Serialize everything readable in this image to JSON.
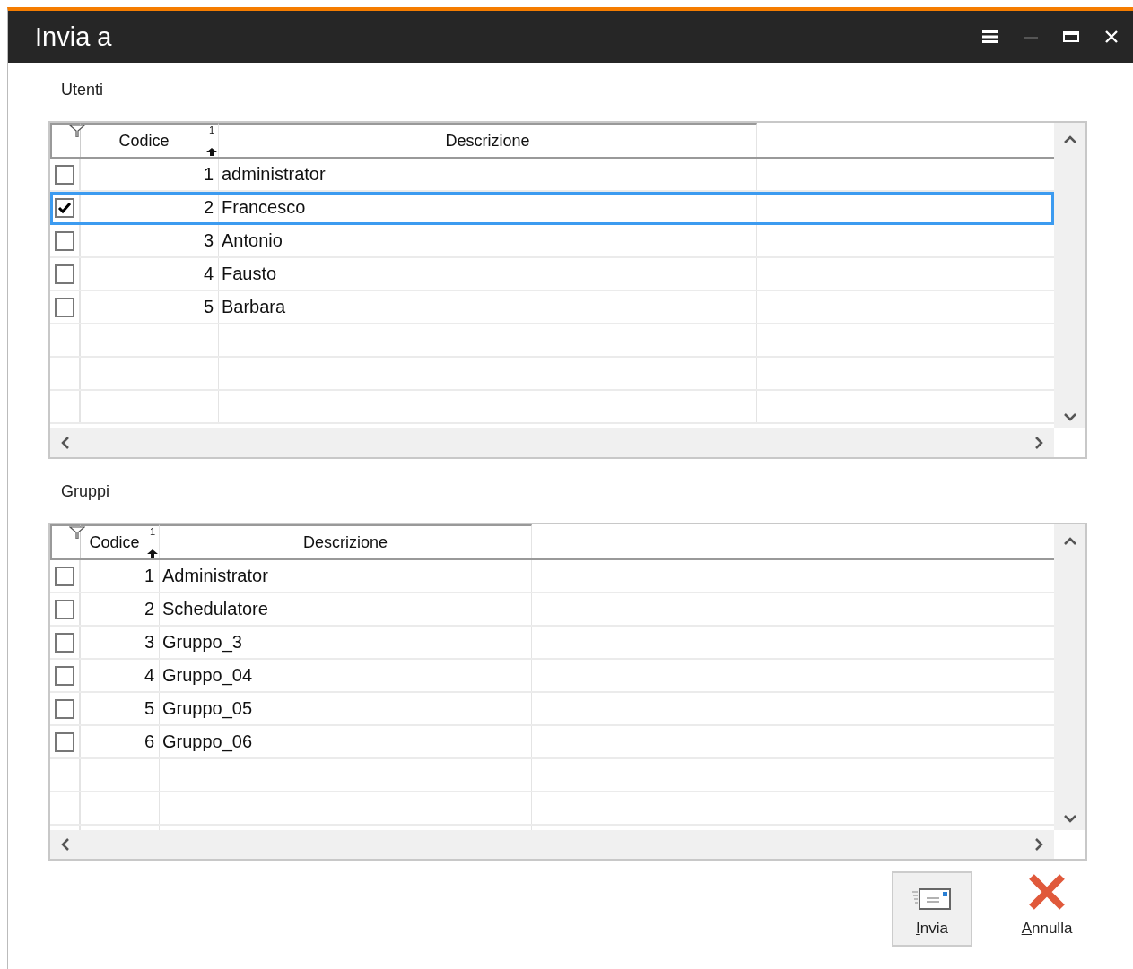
{
  "window": {
    "title": "Invia a"
  },
  "grids": [
    {
      "label": "Utenti",
      "columns": [
        {
          "title": "Codice",
          "sort_order": "1"
        },
        {
          "title": "Descrizione"
        }
      ],
      "rows": [
        {
          "code": "1",
          "description": "administrator",
          "checked": false,
          "selected": false
        },
        {
          "code": "2",
          "description": "Francesco",
          "checked": true,
          "selected": true
        },
        {
          "code": "3",
          "description": "Antonio",
          "checked": false,
          "selected": false
        },
        {
          "code": "4",
          "description": "Fausto",
          "checked": false,
          "selected": false
        },
        {
          "code": "5",
          "description": "Barbara",
          "checked": false,
          "selected": false
        }
      ]
    },
    {
      "label": "Gruppi",
      "columns": [
        {
          "title": "Codice",
          "sort_order": "1"
        },
        {
          "title": "Descrizione"
        }
      ],
      "rows": [
        {
          "code": "1",
          "description": "Administrator",
          "checked": false,
          "selected": false
        },
        {
          "code": "2",
          "description": "Schedulatore",
          "checked": false,
          "selected": false
        },
        {
          "code": "3",
          "description": "Gruppo_3",
          "checked": false,
          "selected": false
        },
        {
          "code": "4",
          "description": "Gruppo_04",
          "checked": false,
          "selected": false
        },
        {
          "code": "5",
          "description": "Gruppo_05",
          "checked": false,
          "selected": false
        },
        {
          "code": "6",
          "description": "Gruppo_06",
          "checked": false,
          "selected": false
        }
      ]
    }
  ],
  "buttons": [
    {
      "label": "Invia",
      "kind": "send"
    },
    {
      "label": "Annulla",
      "kind": "cancel"
    }
  ]
}
